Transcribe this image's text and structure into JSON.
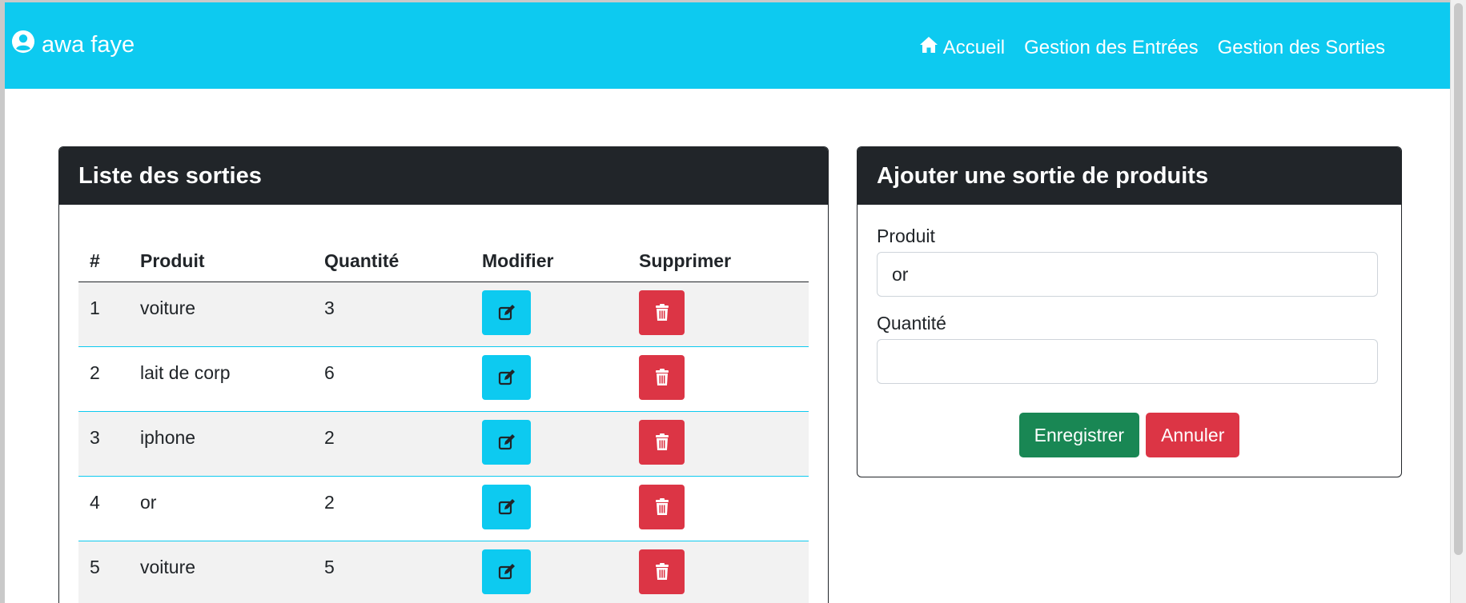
{
  "navbar": {
    "user_name": "awa faye",
    "links": [
      {
        "label": "Accueil",
        "icon": "home-icon"
      },
      {
        "label": "Gestion des Entrées"
      },
      {
        "label": "Gestion des Sorties"
      }
    ]
  },
  "list_card": {
    "title": "Liste des sorties",
    "columns": [
      "#",
      "Produit",
      "Quantité",
      "Modifier",
      "Supprimer"
    ],
    "rows": [
      {
        "id": "1",
        "produit": "voiture",
        "quantite": "3"
      },
      {
        "id": "2",
        "produit": "lait de corp",
        "quantite": "6"
      },
      {
        "id": "3",
        "produit": "iphone",
        "quantite": "2"
      },
      {
        "id": "4",
        "produit": "or",
        "quantite": "2"
      },
      {
        "id": "5",
        "produit": "voiture",
        "quantite": "5"
      }
    ]
  },
  "form_card": {
    "title": "Ajouter une sortie de produits",
    "produit_label": "Produit",
    "produit_value": "or",
    "quantite_label": "Quantité",
    "quantite_value": "",
    "save_label": "Enregistrer",
    "cancel_label": "Annuler"
  },
  "colors": {
    "navbar": "#0dcaf0",
    "card_header": "#212529",
    "edit_button": "#0dcaf0",
    "delete_button": "#dc3545",
    "save_button": "#198754",
    "cancel_button": "#dc3545"
  }
}
